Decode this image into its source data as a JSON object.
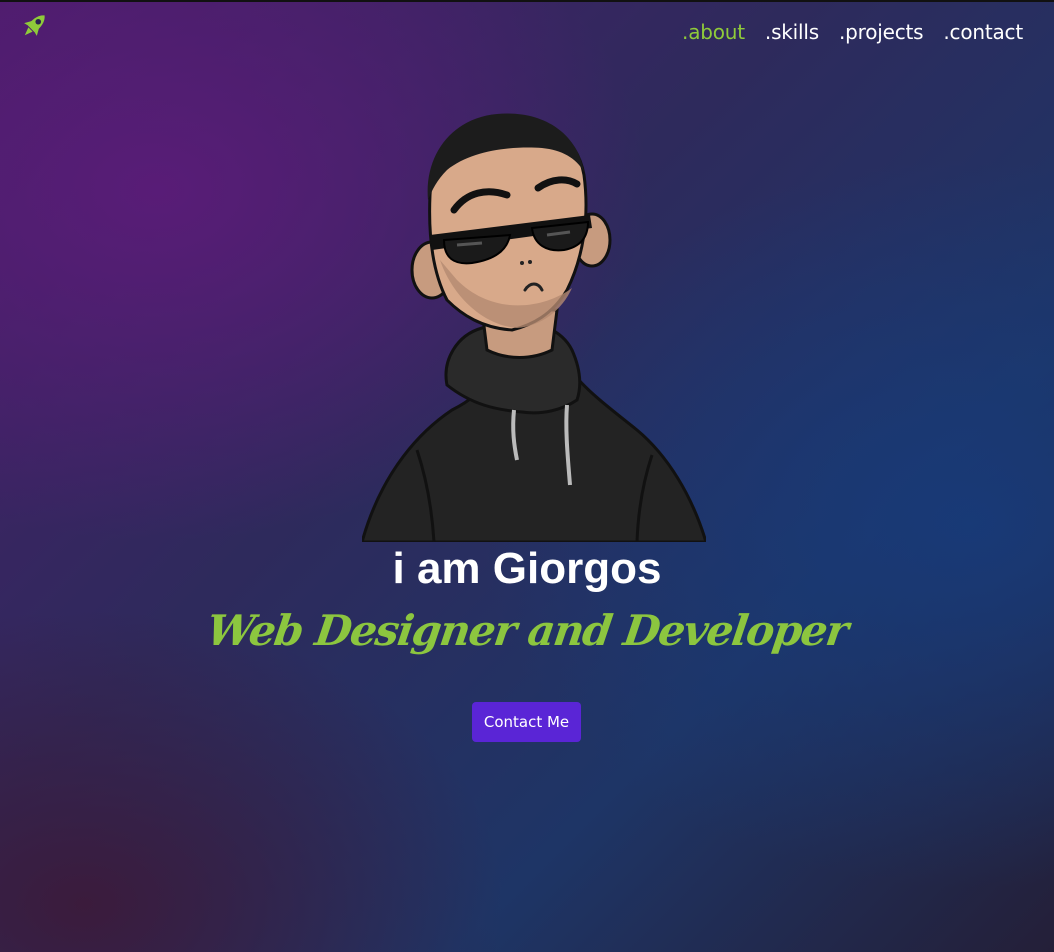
{
  "nav": {
    "items": [
      {
        "label": ".about",
        "active": true
      },
      {
        "label": ".skills",
        "active": false
      },
      {
        "label": ".projects",
        "active": false
      },
      {
        "label": ".contact",
        "active": false
      }
    ]
  },
  "logo": {
    "icon": "rocket-icon",
    "color": "#8fcb3a"
  },
  "hero": {
    "name": "i am Giorgos",
    "role": "Web Designer and Developer",
    "cta_label": "Contact Me"
  },
  "colors": {
    "accent": "#8fcb3a",
    "button": "#5a25d6",
    "text": "#ffffff"
  }
}
